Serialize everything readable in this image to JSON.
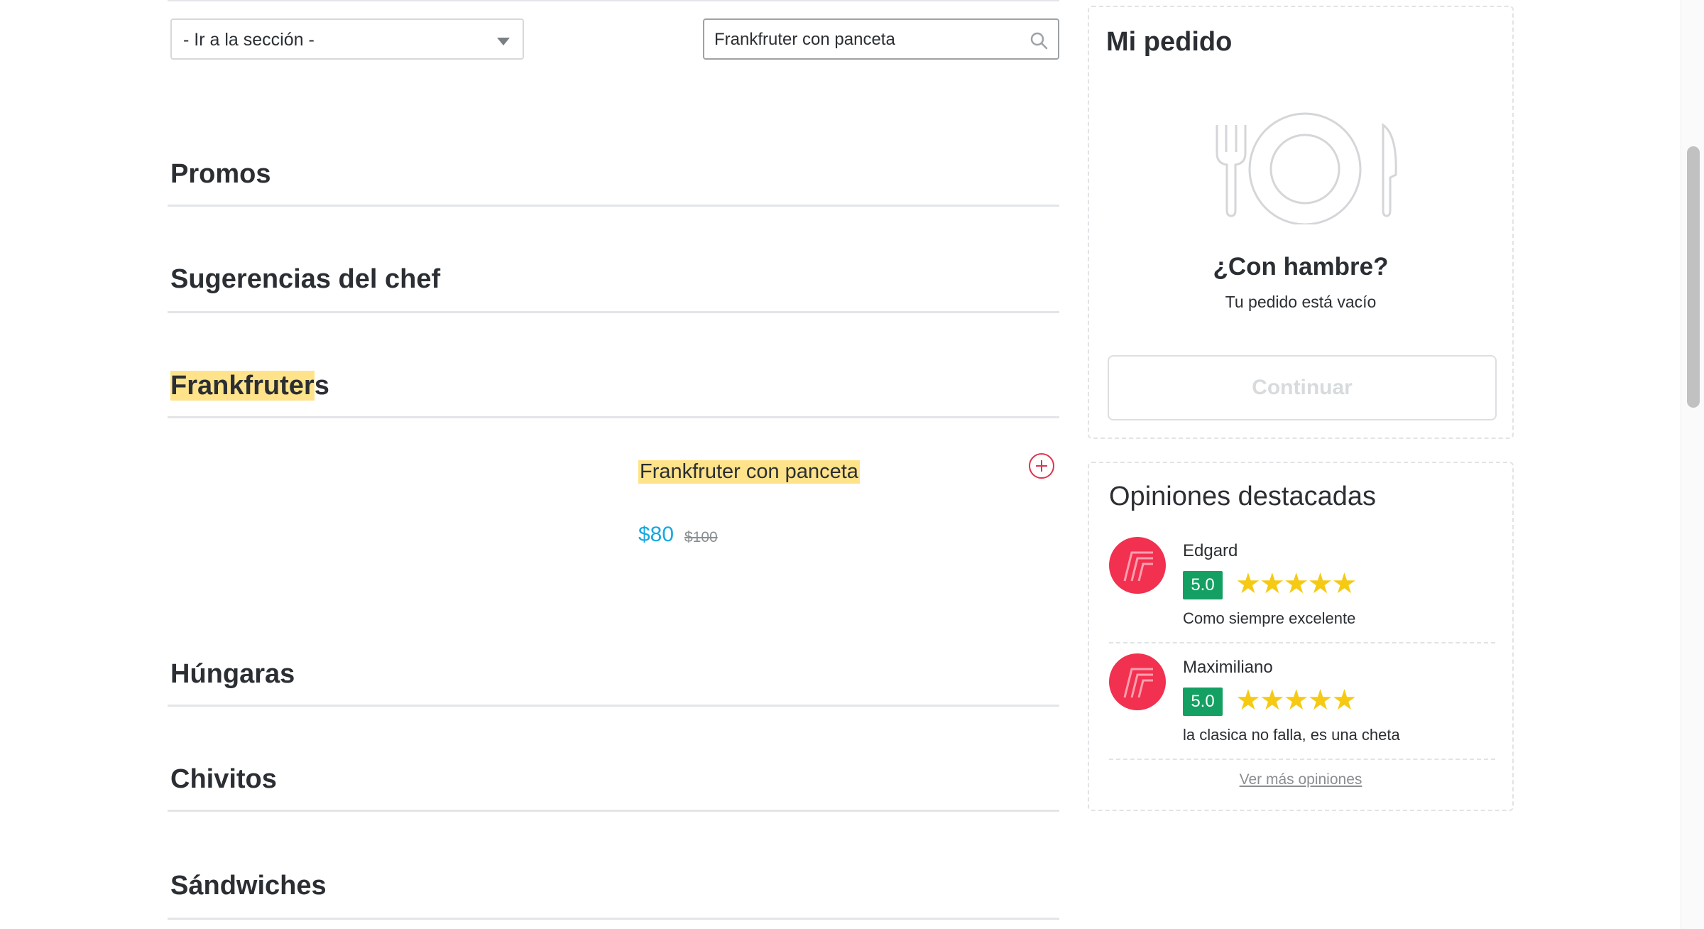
{
  "controls": {
    "section_select_label": "- Ir a la sección -",
    "search_value": "Frankfruter con panceta"
  },
  "menu": {
    "sections": [
      {
        "name": "Promos"
      },
      {
        "name": "Sugerencias del chef"
      },
      {
        "name_highlight": "Frankfruter",
        "name_rest": "s"
      },
      {
        "name": "Húngaras"
      },
      {
        "name": "Chivitos"
      },
      {
        "name": "Sándwiches"
      }
    ],
    "product": {
      "name": "Frankfruter con panceta",
      "price": "$80",
      "old_price": "$100"
    }
  },
  "order": {
    "title": "Mi pedido",
    "hungry": "¿Con hambre?",
    "empty": "Tu pedido está vacío",
    "continue_label": "Continuar"
  },
  "reviews": {
    "title": "Opiniones destacadas",
    "items": [
      {
        "name": "Edgard",
        "score": "5.0",
        "stars": "★★★★★",
        "comment": "Como siempre excelente"
      },
      {
        "name": "Maximiliano",
        "score": "5.0",
        "stars": "★★★★★",
        "comment": "la clasica no falla, es una cheta"
      }
    ],
    "more_link": "Ver más opiniones"
  },
  "colors": {
    "highlight": "#ffe38a",
    "price": "#16a8e0",
    "score_badge": "#14a063",
    "stars": "#f6c913",
    "add_icon": "#e0334a",
    "avatar": "#f2304f"
  }
}
